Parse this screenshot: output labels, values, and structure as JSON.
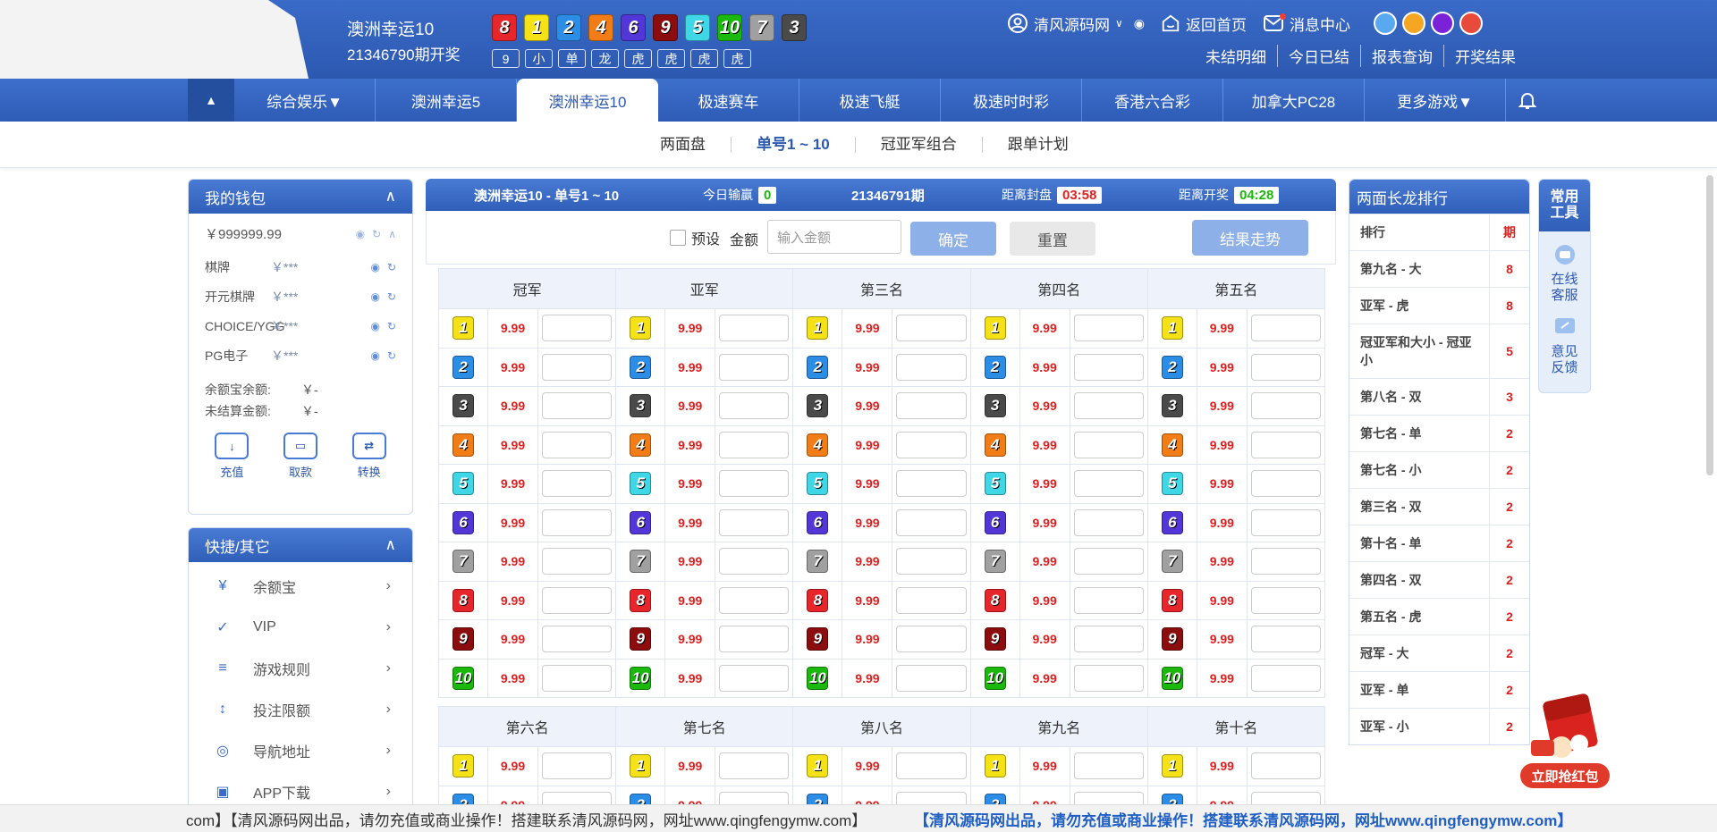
{
  "header": {
    "game_name": "澳洲幸运10",
    "issue": "21346790期开奖",
    "balls": [
      {
        "num": "8",
        "color": "#e6262a"
      },
      {
        "num": "1",
        "color": "#f4e216"
      },
      {
        "num": "2",
        "color": "#2c8de6"
      },
      {
        "num": "4",
        "color": "#f27d17"
      },
      {
        "num": "6",
        "color": "#5236d8"
      },
      {
        "num": "9",
        "color": "#8c0d0d"
      },
      {
        "num": "5",
        "color": "#3fd6e6"
      },
      {
        "num": "10",
        "color": "#1bb80d"
      },
      {
        "num": "7",
        "color": "#a0a0a0"
      },
      {
        "num": "3",
        "color": "#4a4a4a"
      }
    ],
    "tags": [
      "9",
      "小",
      "单",
      "龙",
      "虎",
      "虎",
      "虎",
      "虎"
    ],
    "user": "清风源码网",
    "home": "返回首页",
    "messages": "消息中心",
    "theme_colors": [
      "#5aa8f0",
      "#f5a623",
      "#7a22d8",
      "#e84a3c"
    ],
    "links": [
      "未结明细",
      "今日已结",
      "报表查询",
      "开奖结果"
    ]
  },
  "nav": {
    "items": [
      "综合娱乐▼",
      "澳洲幸运5",
      "澳洲幸运10",
      "极速赛车",
      "极速飞艇",
      "极速时时彩",
      "香港六合彩",
      "加拿大PC28",
      "更多游戏▼"
    ],
    "active_index": 2
  },
  "subnav": [
    "两面盘",
    "单号1 ~ 10",
    "冠亚军组合",
    "跟单计划"
  ],
  "wallet": {
    "title": "我的钱包",
    "balance": "￥999999.99",
    "rows": [
      {
        "name": "棋牌",
        "value": "￥***"
      },
      {
        "name": "开元棋牌",
        "value": "￥***"
      },
      {
        "name": "CHOICE/YGG",
        "value": "￥***"
      },
      {
        "name": "PG电子",
        "value": "￥***"
      }
    ],
    "sums": [
      {
        "name": "余额宝余额:",
        "value": "￥-"
      },
      {
        "name": "未结算金额:",
        "value": "￥-"
      }
    ],
    "actions": [
      "充值",
      "取款",
      "转换"
    ]
  },
  "quick": {
    "title": "快捷/其它",
    "items": [
      "余额宝",
      "VIP",
      "游戏规则",
      "投注限额",
      "导航地址",
      "APP下载"
    ]
  },
  "main": {
    "title": "澳洲幸运10 - 单号1 ~ 10",
    "today_label": "今日输赢",
    "today_value": "0",
    "next_issue": "21346791期",
    "close_label": "距离封盘",
    "close_time": "03:58",
    "draw_label": "距离开奖",
    "draw_time": "04:28",
    "preset_label": "预设",
    "amount_label": "金额",
    "amount_placeholder": "输入金额",
    "confirm": "确定",
    "reset": "重置",
    "trend": "结果走势",
    "headers1": [
      "冠军",
      "亚军",
      "第三名",
      "第四名",
      "第五名"
    ],
    "headers2": [
      "第六名",
      "第七名",
      "第八名",
      "第九名",
      "第十名"
    ],
    "odds": "9.99"
  },
  "longdragon": {
    "title": "两面长龙排行",
    "col1": "排行",
    "col2": "期",
    "rows": [
      {
        "name": "第九名 - 大",
        "count": "8"
      },
      {
        "name": "亚军 - 虎",
        "count": "8"
      },
      {
        "name": "冠亚军和大小 - 冠亚小",
        "count": "5"
      },
      {
        "name": "第八名 - 双",
        "count": "3"
      },
      {
        "name": "第七名 - 单",
        "count": "2"
      },
      {
        "name": "第七名 - 小",
        "count": "2"
      },
      {
        "name": "第三名 - 双",
        "count": "2"
      },
      {
        "name": "第十名 - 单",
        "count": "2"
      },
      {
        "name": "第四名 - 双",
        "count": "2"
      },
      {
        "name": "第五名 - 虎",
        "count": "2"
      },
      {
        "name": "冠军 - 大",
        "count": "2"
      },
      {
        "name": "亚军 - 单",
        "count": "2"
      },
      {
        "name": "亚军 - 小",
        "count": "2"
      }
    ]
  },
  "tools": {
    "title": "常用工具",
    "service": "在线客服",
    "feedback": "意见反馈"
  },
  "redpacket": "立即抢红包",
  "ticker": {
    "t1": "com】【清风源码网出品，请勿充值或商业操作！搭建联系清风源码网，网址www.qingfengymw.com】",
    "t2": "【清风源码网出品，请勿充值或商业操作！搭建联系清风源码网，网址www.qingfengymw.com】"
  }
}
